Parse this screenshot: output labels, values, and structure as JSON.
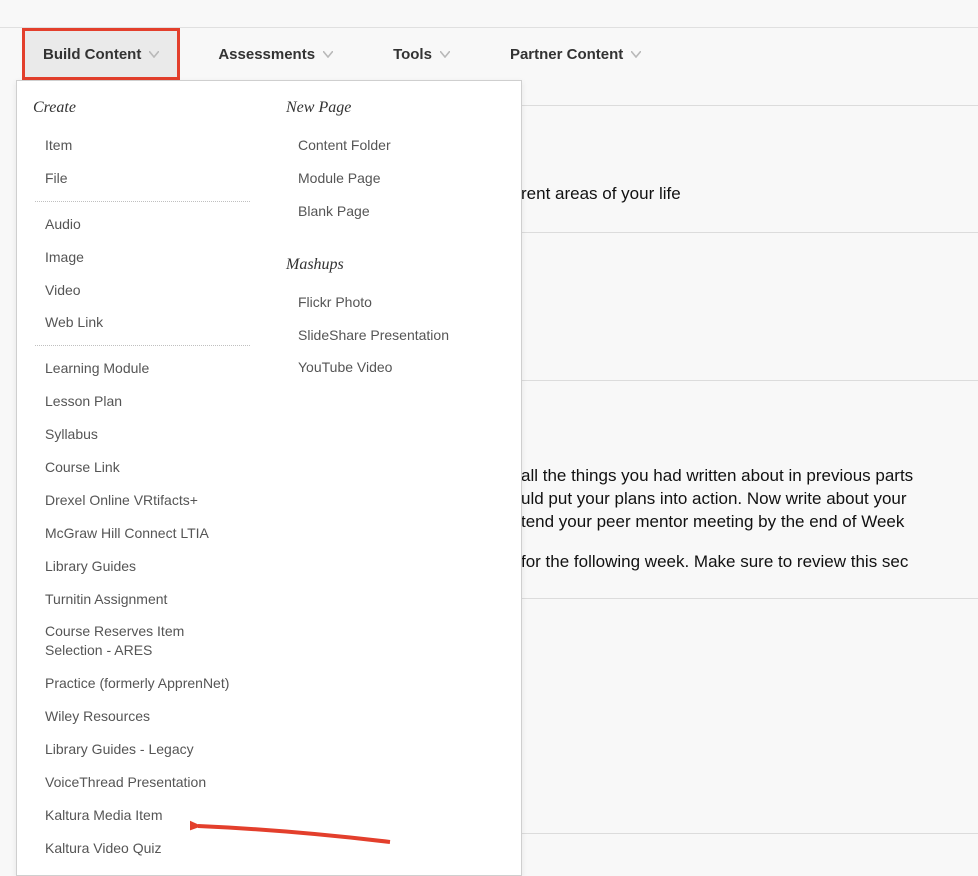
{
  "tabs": {
    "build_content": "Build Content",
    "assessments": "Assessments",
    "tools": "Tools",
    "partner_content": "Partner Content"
  },
  "dropdown": {
    "create": {
      "title": "Create",
      "group1": [
        "Item",
        "File"
      ],
      "group2": [
        "Audio",
        "Image",
        "Video",
        "Web Link"
      ],
      "group3": [
        "Learning Module",
        "Lesson Plan",
        "Syllabus",
        "Course Link",
        "Drexel Online VRtifacts+",
        "McGraw Hill Connect LTIA",
        "Library Guides",
        "Turnitin Assignment",
        "Course Reserves Item Selection - ARES",
        "Practice (formerly ApprenNet)",
        "Wiley Resources",
        "Library Guides - Legacy",
        "VoiceThread Presentation",
        "Kaltura Media Item",
        "Kaltura Video Quiz"
      ]
    },
    "new_page": {
      "title": "New Page",
      "items": [
        "Content Folder",
        "Module Page",
        "Blank Page"
      ]
    },
    "mashups": {
      "title": "Mashups",
      "items": [
        "Flickr Photo",
        "SlideShare Presentation",
        "YouTube Video"
      ]
    }
  },
  "background": {
    "line1": "rent areas of your life",
    "line2": "all the things you had written about in previous parts",
    "line3": "uld put your plans into action.  Now write about your",
    "line4": "tend your peer mentor meeting by the end of Week",
    "line5": " for the following week. Make sure to review this sec"
  }
}
